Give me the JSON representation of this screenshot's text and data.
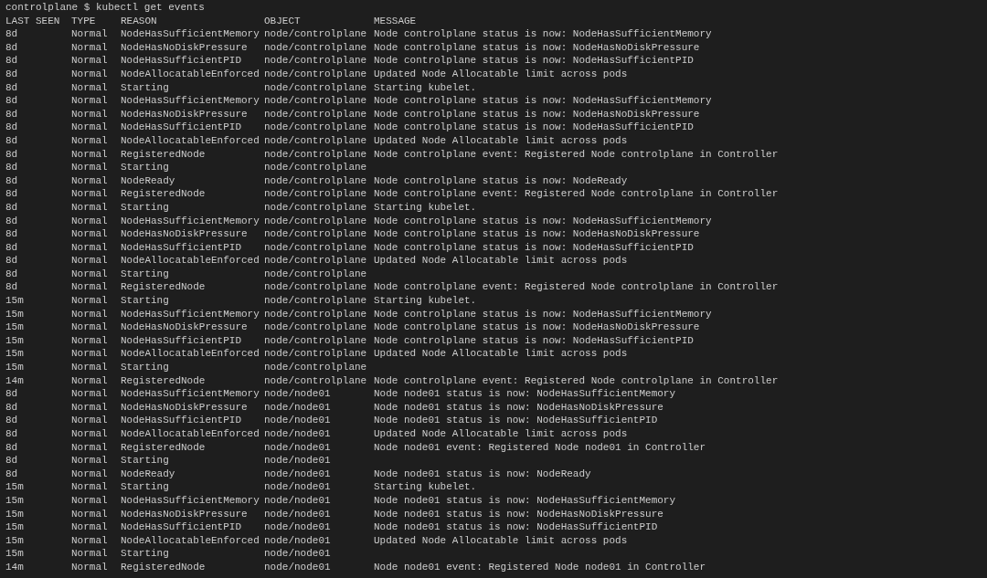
{
  "prompt": "controlplane $ kubectl get events",
  "columns": [
    "LAST SEEN",
    "TYPE",
    "REASON",
    "OBJECT",
    "MESSAGE"
  ],
  "rows": [
    {
      "last_seen": "8d",
      "type": "Normal",
      "reason": "NodeHasSufficientMemory",
      "object": "node/controlplane",
      "message": "Node controlplane status is now: NodeHasSufficientMemory"
    },
    {
      "last_seen": "8d",
      "type": "Normal",
      "reason": "NodeHasNoDiskPressure",
      "object": "node/controlplane",
      "message": "Node controlplane status is now: NodeHasNoDiskPressure"
    },
    {
      "last_seen": "8d",
      "type": "Normal",
      "reason": "NodeHasSufficientPID",
      "object": "node/controlplane",
      "message": "Node controlplane status is now: NodeHasSufficientPID"
    },
    {
      "last_seen": "8d",
      "type": "Normal",
      "reason": "NodeAllocatableEnforced",
      "object": "node/controlplane",
      "message": "Updated Node Allocatable limit across pods"
    },
    {
      "last_seen": "8d",
      "type": "Normal",
      "reason": "Starting",
      "object": "node/controlplane",
      "message": "Starting kubelet."
    },
    {
      "last_seen": "8d",
      "type": "Normal",
      "reason": "NodeHasSufficientMemory",
      "object": "node/controlplane",
      "message": "Node controlplane status is now: NodeHasSufficientMemory"
    },
    {
      "last_seen": "8d",
      "type": "Normal",
      "reason": "NodeHasNoDiskPressure",
      "object": "node/controlplane",
      "message": "Node controlplane status is now: NodeHasNoDiskPressure"
    },
    {
      "last_seen": "8d",
      "type": "Normal",
      "reason": "NodeHasSufficientPID",
      "object": "node/controlplane",
      "message": "Node controlplane status is now: NodeHasSufficientPID"
    },
    {
      "last_seen": "8d",
      "type": "Normal",
      "reason": "NodeAllocatableEnforced",
      "object": "node/controlplane",
      "message": "Updated Node Allocatable limit across pods"
    },
    {
      "last_seen": "8d",
      "type": "Normal",
      "reason": "RegisteredNode",
      "object": "node/controlplane",
      "message": "Node controlplane event: Registered Node controlplane in Controller"
    },
    {
      "last_seen": "8d",
      "type": "Normal",
      "reason": "Starting",
      "object": "node/controlplane"
    },
    {
      "last_seen": "8d",
      "type": "Normal",
      "reason": "NodeReady",
      "object": "node/controlplane",
      "message": "Node controlplane status is now: NodeReady"
    },
    {
      "last_seen": "8d",
      "type": "Normal",
      "reason": "RegisteredNode",
      "object": "node/controlplane",
      "message": "Node controlplane event: Registered Node controlplane in Controller"
    },
    {
      "last_seen": "8d",
      "type": "Normal",
      "reason": "Starting",
      "object": "node/controlplane",
      "message": "Starting kubelet."
    },
    {
      "last_seen": "8d",
      "type": "Normal",
      "reason": "NodeHasSufficientMemory",
      "object": "node/controlplane",
      "message": "Node controlplane status is now: NodeHasSufficientMemory"
    },
    {
      "last_seen": "8d",
      "type": "Normal",
      "reason": "NodeHasNoDiskPressure",
      "object": "node/controlplane",
      "message": "Node controlplane status is now: NodeHasNoDiskPressure"
    },
    {
      "last_seen": "8d",
      "type": "Normal",
      "reason": "NodeHasSufficientPID",
      "object": "node/controlplane",
      "message": "Node controlplane status is now: NodeHasSufficientPID"
    },
    {
      "last_seen": "8d",
      "type": "Normal",
      "reason": "NodeAllocatableEnforced",
      "object": "node/controlplane",
      "message": "Updated Node Allocatable limit across pods"
    },
    {
      "last_seen": "8d",
      "type": "Normal",
      "reason": "Starting",
      "object": "node/controlplane"
    },
    {
      "last_seen": "8d",
      "type": "Normal",
      "reason": "RegisteredNode",
      "object": "node/controlplane",
      "message": "Node controlplane event: Registered Node controlplane in Controller"
    },
    {
      "last_seen": "15m",
      "type": "Normal",
      "reason": "Starting",
      "object": "node/controlplane",
      "message": "Starting kubelet."
    },
    {
      "last_seen": "15m",
      "type": "Normal",
      "reason": "NodeHasSufficientMemory",
      "object": "node/controlplane",
      "message": "Node controlplane status is now: NodeHasSufficientMemory"
    },
    {
      "last_seen": "15m",
      "type": "Normal",
      "reason": "NodeHasNoDiskPressure",
      "object": "node/controlplane",
      "message": "Node controlplane status is now: NodeHasNoDiskPressure"
    },
    {
      "last_seen": "15m",
      "type": "Normal",
      "reason": "NodeHasSufficientPID",
      "object": "node/controlplane",
      "message": "Node controlplane status is now: NodeHasSufficientPID"
    },
    {
      "last_seen": "15m",
      "type": "Normal",
      "reason": "NodeAllocatableEnforced",
      "object": "node/controlplane",
      "message": "Updated Node Allocatable limit across pods"
    },
    {
      "last_seen": "15m",
      "type": "Normal",
      "reason": "Starting",
      "object": "node/controlplane"
    },
    {
      "last_seen": "14m",
      "type": "Normal",
      "reason": "RegisteredNode",
      "object": "node/controlplane",
      "message": "Node controlplane event: Registered Node controlplane in Controller"
    },
    {
      "last_seen": "8d",
      "type": "Normal",
      "reason": "NodeHasSufficientMemory",
      "object": "node/node01",
      "message": "Node node01 status is now: NodeHasSufficientMemory"
    },
    {
      "last_seen": "8d",
      "type": "Normal",
      "reason": "NodeHasNoDiskPressure",
      "object": "node/node01",
      "message": "Node node01 status is now: NodeHasNoDiskPressure"
    },
    {
      "last_seen": "8d",
      "type": "Normal",
      "reason": "NodeHasSufficientPID",
      "object": "node/node01",
      "message": "Node node01 status is now: NodeHasSufficientPID"
    },
    {
      "last_seen": "8d",
      "type": "Normal",
      "reason": "NodeAllocatableEnforced",
      "object": "node/node01",
      "message": "Updated Node Allocatable limit across pods"
    },
    {
      "last_seen": "8d",
      "type": "Normal",
      "reason": "RegisteredNode",
      "object": "node/node01",
      "message": "Node node01 event: Registered Node node01 in Controller"
    },
    {
      "last_seen": "8d",
      "type": "Normal",
      "reason": "Starting",
      "object": "node/node01"
    },
    {
      "last_seen": "8d",
      "type": "Normal",
      "reason": "NodeReady",
      "object": "node/node01",
      "message": "Node node01 status is now: NodeReady"
    },
    {
      "last_seen": "15m",
      "type": "Normal",
      "reason": "Starting",
      "object": "node/node01",
      "message": "Starting kubelet."
    },
    {
      "last_seen": "15m",
      "type": "Normal",
      "reason": "NodeHasSufficientMemory",
      "object": "node/node01",
      "message": "Node node01 status is now: NodeHasSufficientMemory"
    },
    {
      "last_seen": "15m",
      "type": "Normal",
      "reason": "NodeHasNoDiskPressure",
      "object": "node/node01",
      "message": "Node node01 status is now: NodeHasNoDiskPressure"
    },
    {
      "last_seen": "15m",
      "type": "Normal",
      "reason": "NodeHasSufficientPID",
      "object": "node/node01",
      "message": "Node node01 status is now: NodeHasSufficientPID"
    },
    {
      "last_seen": "15m",
      "type": "Normal",
      "reason": "NodeAllocatableEnforced",
      "object": "node/node01",
      "message": "Updated Node Allocatable limit across pods"
    },
    {
      "last_seen": "15m",
      "type": "Normal",
      "reason": "Starting",
      "object": "node/node01"
    },
    {
      "last_seen": "14m",
      "type": "Normal",
      "reason": "RegisteredNode",
      "object": "node/node01",
      "message": "Node node01 event: Registered Node node01 in Controller"
    }
  ]
}
